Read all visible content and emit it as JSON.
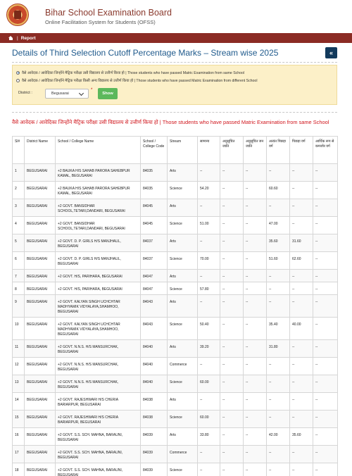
{
  "header": {
    "title": "Bihar School Examination Board",
    "subtitle": "Online Facilitation System for Students (OFSS)"
  },
  "nav": {
    "separator": "|",
    "breadcrumb": "Report"
  },
  "page": {
    "title": "Details of Third Selection Cutoff Percentage Marks – Stream wise 2025",
    "back_icon": "«"
  },
  "filters": {
    "option_same": "वैसे आवेदक / आवेदिका जिन्होंने मैट्रिक परीक्षा उसी विद्यालय से उत्तीर्ण किया हो | Those students who have passed Matric Examination from same School",
    "option_different": "वैसे आवेदक / आवेदिका जिन्होंने मैट्रिक परीक्षा किसी अन्य विद्यालय से उत्तीर्ण किया हो | Those students who have passed Matric Examination from different School",
    "district_label": "District :",
    "district_value": "Begusarai",
    "required_mark": "*",
    "show_button": "Show"
  },
  "section_heading": "वैसे आवेदक / आवेदिका जिन्होंने मैट्रिक परीक्षा उसी विद्यालय से उत्तीर्ण किया हो | Those students who have passed Matric Examination from same School",
  "table": {
    "headers": [
      "Sl#",
      "District Name",
      "School / College Name",
      "School / College Code",
      "Stream",
      "सामान्य",
      "अनुसूचित जाति",
      "अनुसूचित जन जाति",
      "अत्यंत पिछड़ा वर्ग",
      "पिछड़ा वर्ग",
      "आर्थिक रूप से कमजोर वर्ग"
    ],
    "rows": [
      [
        "1",
        "BEGUSARAI",
        "+2 BAUKA H/S SAHAB PARORA SAHEBPUR KAMAL, BEGUSARAI",
        "84035",
        "Arts",
        "--",
        "--",
        "--",
        "--",
        "--",
        "--"
      ],
      [
        "2",
        "BEGUSARAI",
        "+2 BAUKA H/S SAHAB PARORA SAHEBPUR KAMAL, BEGUSARAI",
        "84035",
        "Science",
        "54.20",
        "--",
        "--",
        "60.60",
        "--",
        "--"
      ],
      [
        "3",
        "BEGUSARAI",
        "+2 GOVT. BANSIDHAR SCHOOL,TETARI,DANDARI, BEGUSARAI",
        "84045",
        "Arts",
        "--",
        "--",
        "--",
        "--",
        "--",
        "--"
      ],
      [
        "4",
        "BEGUSARAI",
        "+2 GOVT. BANSIDHAR SCHOOL,TETARI,DANDARI, BEGUSARAI",
        "84045",
        "Science",
        "51.00",
        "--",
        "--",
        "47.00",
        "--",
        "--"
      ],
      [
        "5",
        "BEGUSARAI",
        "+2 GOVT. D. P. GIRLS H/S MANJHAUL, BEGUSARAI",
        "84037",
        "Arts",
        "--",
        "--",
        "--",
        "35.60",
        "31.60",
        "--"
      ],
      [
        "6",
        "BEGUSARAI",
        "+2 GOVT. D. P. GIRLS H/S MANJHAUL, BEGUSARAI",
        "84037",
        "Science",
        "70.00",
        "--",
        "--",
        "51.60",
        "62.60",
        "--"
      ],
      [
        "7",
        "BEGUSARAI",
        "+2 GOVT. H/S, PARIHARA, BEGUSARAI",
        "84047",
        "Arts",
        "--",
        "--",
        "--",
        "--",
        "--",
        "--"
      ],
      [
        "8",
        "BEGUSARAI",
        "+2 GOVT. H/S, PARIHARA, BEGUSARAI",
        "84047",
        "Science",
        "57.80",
        "--",
        "--",
        "--",
        "--",
        "--"
      ],
      [
        "9",
        "BEGUSARAI",
        "+2 GOVT. KALYAN SINGH UCHCHTAR MADHYAMIK VIDYALAYA,SHAMHOO, BEGUSARAI",
        "84043",
        "Arts",
        "--",
        "--",
        "--",
        "--",
        "--",
        "--"
      ],
      [
        "10",
        "BEGUSARAI",
        "+2 GOVT. KALYAN SINGH UCHCHTAR MADHYAMIK VIDYALAYA,SHAMHOO, BEGUSARAI",
        "84043",
        "Science",
        "50.40",
        "--",
        "--",
        "35.40",
        "40.00",
        "--"
      ],
      [
        "11",
        "BEGUSARAI",
        "+2 GOVT. N.N.S. H/S MANSURCHAK, BEGUSARAI",
        "84040",
        "Arts",
        "39.20",
        "--",
        "--",
        "31.80",
        "--",
        "--"
      ],
      [
        "12",
        "BEGUSARAI",
        "+2 GOVT. N.N.S. H/S MANSURCHAK, BEGUSARAI",
        "84040",
        "Commerce",
        "--",
        "--",
        "--",
        "--",
        "--",
        "--"
      ],
      [
        "13",
        "BEGUSARAI",
        "+2 GOVT. N.N.S. H/S MANSURCHAK, BEGUSARAI",
        "84040",
        "Science",
        "60.00",
        "--",
        "--",
        "--",
        "--",
        "--"
      ],
      [
        "14",
        "BEGUSARAI",
        "+2 GOVT. RAJESHWARI H/S CHERIA BARIARPUR, BEGUSARAI",
        "84038",
        "Arts",
        "--",
        "--",
        "--",
        "--",
        "--",
        "--"
      ],
      [
        "15",
        "BEGUSARAI",
        "+2 GOVT. RAJESHWARI H/S CHERIA BARIARPUR, BEGUSARAI",
        "84038",
        "Science",
        "60.00",
        "--",
        "--",
        "--",
        "--",
        "--"
      ],
      [
        "16",
        "BEGUSARAI",
        "+2 GOVT. S.S. SCH. MAHNA, BARAUNI, BEGUSARAI",
        "84039",
        "Arts",
        "33.80",
        "--",
        "--",
        "42.00",
        "35.60",
        "--"
      ],
      [
        "17",
        "BEGUSARAI",
        "+2 GOVT. S.S. SCH. MAHNA, BARAUNI, BEGUSARAI",
        "84039",
        "Commerce",
        "--",
        "--",
        "--",
        "--",
        "--",
        "--"
      ],
      [
        "18",
        "BEGUSARAI",
        "+2 GOVT. S.S. SCH. MAHNA, BARAUNI, BEGUSARAI",
        "84039",
        "Science",
        "--",
        "--",
        "--",
        "--",
        "--",
        "--"
      ]
    ]
  }
}
